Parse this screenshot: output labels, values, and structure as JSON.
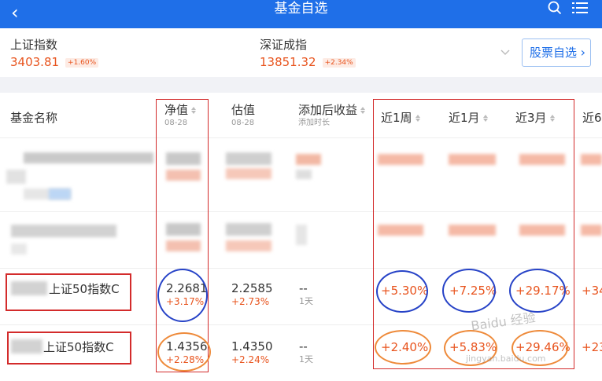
{
  "topbar": {
    "back_icon": "chevron-left-icon",
    "title": "基金自选",
    "search_icon": "search-icon",
    "menu_icon": "list-menu-icon"
  },
  "indices": [
    {
      "name": "上证指数",
      "value": "3403.81",
      "change": "+1.60%"
    },
    {
      "name": "深证成指",
      "value": "13851.32",
      "change": "+2.34%"
    }
  ],
  "stock_watchlist_button": {
    "label": "股票自选",
    "icon": "chevron-right-icon"
  },
  "table": {
    "headers": {
      "fund_name": "基金名称",
      "nav": {
        "label": "净值",
        "date": "08-28"
      },
      "estimate": {
        "label": "估值",
        "date": "08-28"
      },
      "since_added": {
        "label": "添加后收益",
        "sub": "添加时长"
      },
      "week1": "近1周",
      "month1": "近1月",
      "month3": "近3月",
      "month6": "近6"
    },
    "rows": [
      {
        "name": "",
        "nav": "",
        "nav_chg": "",
        "est": "",
        "est_chg": "",
        "added": "",
        "added_time": "",
        "w1": "",
        "m1": "",
        "m3": "",
        "m6": ""
      },
      {
        "name": "",
        "nav": "",
        "nav_chg": "",
        "est": "",
        "est_chg": "",
        "added": "",
        "added_time": "",
        "w1": "",
        "m1": "",
        "m3": "",
        "m6": ""
      },
      {
        "name": "上证50指数C",
        "nav": "2.2681",
        "nav_chg": "+3.17%",
        "est": "2.2585",
        "est_chg": "+2.73%",
        "added": "--",
        "added_time": "1天",
        "w1": "+5.30%",
        "m1": "+7.25%",
        "m3": "+29.17%",
        "m6": "+34"
      },
      {
        "name": "上证50指数C",
        "nav": "1.4356",
        "nav_chg": "+2.28%",
        "est": "1.4350",
        "est_chg": "+2.24%",
        "added": "--",
        "added_time": "1天",
        "w1": "+2.40%",
        "m1": "+5.83%",
        "m3": "+29.46%",
        "m6": "+23"
      }
    ]
  },
  "watermark": {
    "line1": "Baidu 经验",
    "line2": "jingyan.baidu.com"
  },
  "colors": {
    "brand_blue": "#1f6fe8",
    "up_red": "#e8541e",
    "annotation_red": "#d32b2b",
    "annotation_blue": "#2743c7",
    "annotation_orange": "#ee8a3a"
  }
}
